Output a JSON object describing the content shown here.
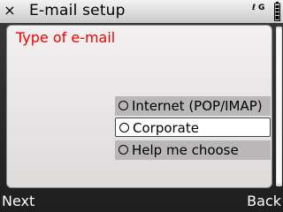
{
  "titlebar": {
    "close_glyph": "×",
    "close_icon": "close-icon",
    "title": "E-mail setup",
    "indicator_glyph": "Ǝ",
    "indicator_text": "G",
    "battery_icon": "battery-icon"
  },
  "panel": {
    "heading": "Type of e-mail",
    "options": [
      {
        "label": "Internet (POP/IMAP)",
        "selected": false
      },
      {
        "label": "Corporate",
        "selected": true
      },
      {
        "label": "Help me choose",
        "selected": false
      }
    ]
  },
  "softkeys": {
    "left": "Next",
    "right": "Back"
  },
  "colors": {
    "heading": "#f00000",
    "highlight": "#ffffff",
    "option_bg": "#b9b7b7",
    "softkey_bar": "#1e1e1e"
  }
}
